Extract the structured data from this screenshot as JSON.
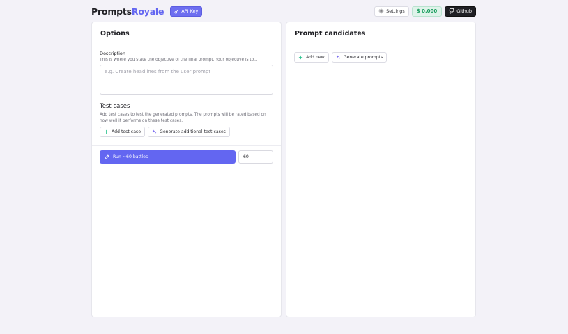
{
  "header": {
    "brand_part1": "Prompts",
    "brand_part2": "Royale",
    "api_key_label": "API Key",
    "settings_label": "Settings",
    "balance": "$ 0.000",
    "github_label": "Github"
  },
  "options": {
    "title": "Options",
    "description": {
      "label": "Description",
      "help": "This is where you state the objective of the final prompt. Your objective is to...",
      "value": "",
      "placeholder": "e.g. Create headlines from the user prompt"
    },
    "test_cases": {
      "title": "Test cases",
      "help": "Add test cases to test the generated prompts. The prompts will be rated based on how well it performs on these test cases.",
      "add_label": "Add test case",
      "generate_label": "Generate additional test cases"
    },
    "run": {
      "label": "Run ~60 battles",
      "battles_value": "60"
    }
  },
  "candidates": {
    "title": "Prompt candidates",
    "add_new_label": "Add new",
    "generate_label": "Generate prompts"
  },
  "colors": {
    "accent": "#6366f1",
    "balance_green": "#1a9e5e",
    "background": "#f3f2f8"
  },
  "icons": {
    "api_key": "key-icon",
    "settings": "gear-icon",
    "github": "github-icon",
    "add": "plus-icon",
    "generate": "sparkles-icon",
    "run": "pencil-icon"
  }
}
